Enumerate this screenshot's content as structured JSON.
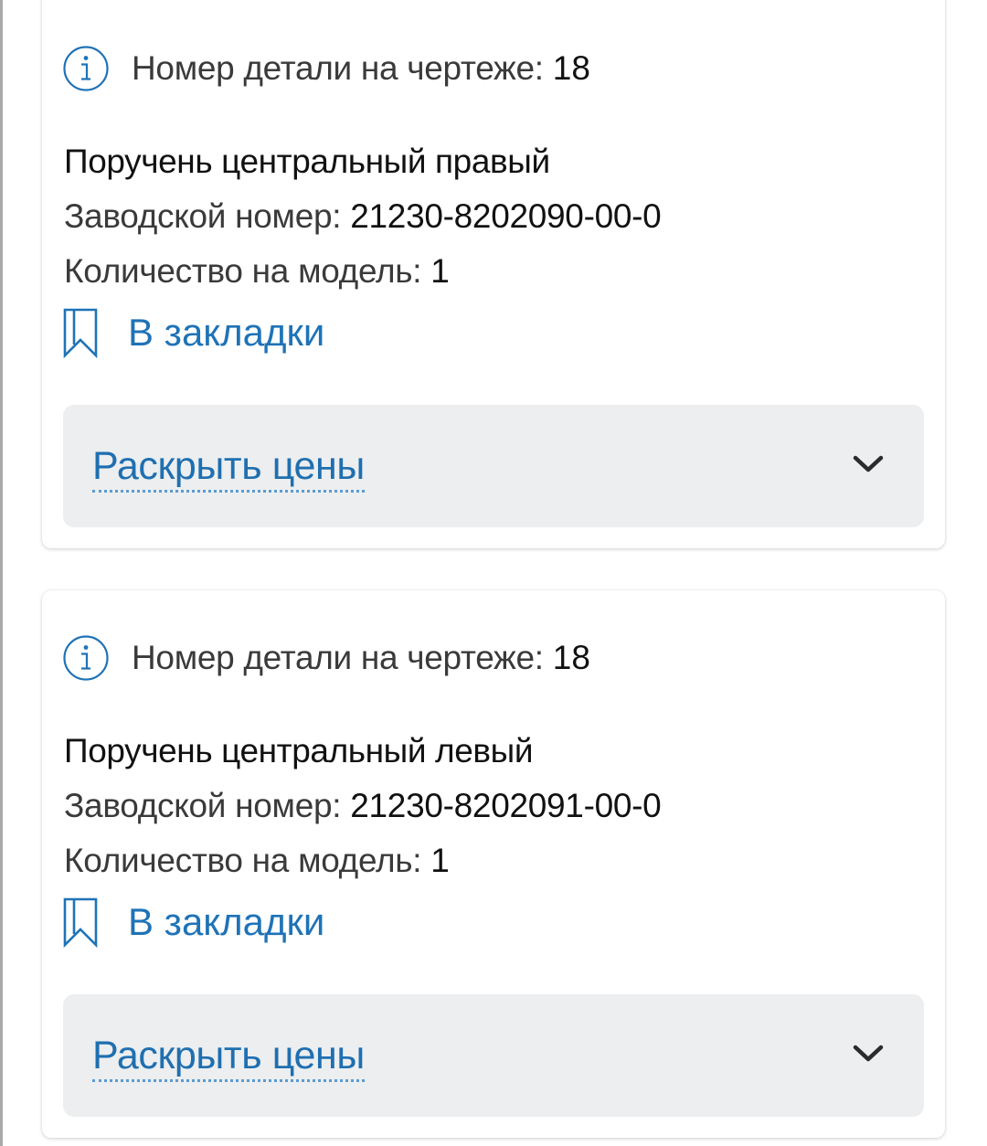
{
  "items": [
    {
      "drawing_label": "Номер детали на чертеже:",
      "drawing_number": "18",
      "name": "Поручень центральный правый",
      "factory_label": "Заводской номер:",
      "factory_number": "21230-8202090-00-0",
      "qty_label": "Количество на модель:",
      "qty_value": "1",
      "bookmark_label": "В закладки",
      "prices_label": "Раскрыть цены"
    },
    {
      "drawing_label": "Номер детали на чертеже:",
      "drawing_number": "18",
      "name": "Поручень центральный левый",
      "factory_label": "Заводской номер:",
      "factory_number": "21230-8202091-00-0",
      "qty_label": "Количество на модель:",
      "qty_value": "1",
      "bookmark_label": "В закладки",
      "prices_label": "Раскрыть цены"
    }
  ],
  "icons": {
    "info": "info-circle-icon",
    "bookmark": "bookmark-outline-icon",
    "chevron": "chevron-down-icon"
  },
  "colors": {
    "link": "#1f73b7",
    "panel": "#eceeef",
    "text": "#111111",
    "muted": "#3a3a3a"
  }
}
